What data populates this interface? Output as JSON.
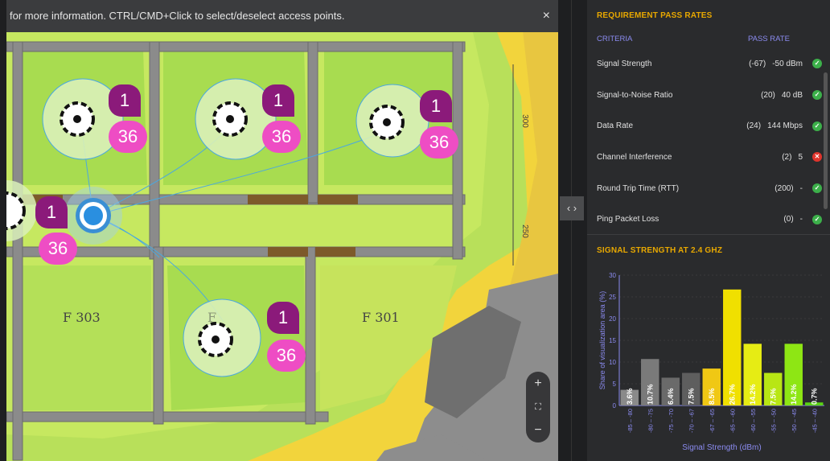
{
  "banner": {
    "text": "for more information. CTRL/CMD+Click to select/deselect access points.",
    "close": "×"
  },
  "map": {
    "rooms": [
      "F 303",
      "F 301"
    ],
    "wall_marks": [
      "300",
      "250"
    ],
    "access_points": [
      {
        "channel": "1",
        "count": "36",
        "selected": false
      },
      {
        "channel": "1",
        "count": "36",
        "selected": false
      },
      {
        "channel": "1",
        "count": "36",
        "selected": false
      },
      {
        "channel": "1",
        "count": "36",
        "selected": false
      },
      {
        "channel": "1",
        "count": "36",
        "selected": true
      }
    ],
    "zoom": {
      "in": "+",
      "fit": "⛶",
      "out": "−"
    }
  },
  "toggle": {
    "label": "‹ ›"
  },
  "pass_rates": {
    "title": "REQUIREMENT PASS RATES",
    "col_criteria": "CRITERIA",
    "col_pass": "PASS RATE",
    "rows": [
      {
        "name": "Signal Strength",
        "req": "(-67)",
        "value": "-50 dBm",
        "pass": true
      },
      {
        "name": "Signal-to-Noise Ratio",
        "req": "(20)",
        "value": "40 dB",
        "pass": true
      },
      {
        "name": "Data Rate",
        "req": "(24)",
        "value": "144 Mbps",
        "pass": true
      },
      {
        "name": "Channel Interference",
        "req": "(2)",
        "value": "5",
        "pass": false
      },
      {
        "name": "Round Trip Time (RTT)",
        "req": "(200)",
        "value": "-",
        "pass": true
      },
      {
        "name": "Ping Packet Loss",
        "req": "(0)",
        "value": "-",
        "pass": true
      }
    ]
  },
  "signal": {
    "title": "SIGNAL STRENGTH AT 2.4 GHZ"
  },
  "chart_data": {
    "type": "bar",
    "xlabel": "Signal Strength (dBm)",
    "ylabel": "Share of visualization area (%)",
    "ylim": [
      0,
      30
    ],
    "yticks": [
      0,
      5,
      10,
      15,
      20,
      25,
      30
    ],
    "categories": [
      "-85 – -80",
      "-80 – -75",
      "-75 – -70",
      "-70 – -67",
      "-67 – -65",
      "-65 – -60",
      "-60 – -55",
      "-55 – -50",
      "-50 – -45",
      "-45 – -40"
    ],
    "values": [
      3.6,
      10.7,
      6.4,
      7.5,
      8.5,
      26.7,
      14.2,
      7.5,
      14.2,
      0.7
    ],
    "labels": [
      "3.6%",
      "10.7%",
      "6.4%",
      "7.5%",
      "8.5%",
      "26.7%",
      "14.2%",
      "7.5%",
      "14.2%",
      "0.7%"
    ],
    "colors": [
      "#8a8a8a",
      "#7a7a7a",
      "#6a6a6a",
      "#5e5e5e",
      "#f0c814",
      "#f0e000",
      "#e6ec14",
      "#b8e614",
      "#8ee614",
      "#5ad214"
    ],
    "grid": true
  }
}
